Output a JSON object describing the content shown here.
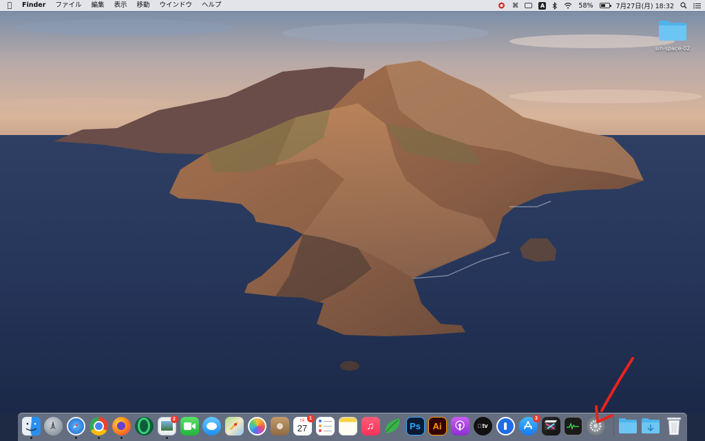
{
  "menubar": {
    "apple_icon": "apple-icon",
    "app_name": "Finder",
    "menus": [
      "ファイル",
      "編集",
      "表示",
      "移動",
      "ウインドウ",
      "ヘルプ"
    ],
    "status": {
      "battery_percent": "58%",
      "clock": "7月27日(月)  18:32",
      "input_source_label": "A",
      "icons": [
        "creative-cloud-icon",
        "command-icon",
        "keyboard-viewer-icon",
        "input-source-icon",
        "bluetooth-icon",
        "wifi-icon",
        "battery-icon",
        "spotlight-icon",
        "control-center-icon"
      ]
    }
  },
  "desktop": {
    "folder_label": "sin-space-02"
  },
  "dock": {
    "apps": [
      {
        "name": "Finder",
        "icon": "finder-icon",
        "running": true
      },
      {
        "name": "Launchpad",
        "icon": "launchpad-icon",
        "running": false
      },
      {
        "name": "Safari",
        "icon": "safari-icon",
        "running": true
      },
      {
        "name": "Google Chrome",
        "icon": "chrome-icon",
        "running": true
      },
      {
        "name": "Firefox",
        "icon": "firefox-icon",
        "running": true
      },
      {
        "name": "Opera",
        "icon": "opera-icon",
        "running": false
      },
      {
        "name": "Preview",
        "icon": "preview-icon",
        "running": true,
        "badge": "2"
      },
      {
        "name": "FaceTime",
        "icon": "facetime-icon",
        "running": false
      },
      {
        "name": "Messages",
        "icon": "messages-icon",
        "running": false
      },
      {
        "name": "Maps",
        "icon": "maps-icon",
        "running": false
      },
      {
        "name": "Photos",
        "icon": "photos-icon",
        "running": false
      },
      {
        "name": "Contacts",
        "icon": "contacts-icon",
        "running": false
      },
      {
        "name": "Calendar",
        "icon": "calendar-icon",
        "running": false,
        "badge": "1",
        "month": "7月",
        "day": "27"
      },
      {
        "name": "Reminders",
        "icon": "reminders-icon",
        "running": false
      },
      {
        "name": "Notes",
        "icon": "notes-icon",
        "running": false
      },
      {
        "name": "Music",
        "icon": "music-icon",
        "running": false
      },
      {
        "name": "Evernote",
        "icon": "evernote-icon",
        "running": false
      },
      {
        "name": "Photoshop",
        "icon": "photoshop-icon",
        "running": false,
        "label": "Ps"
      },
      {
        "name": "Illustrator",
        "icon": "illustrator-icon",
        "running": false,
        "label": "Ai"
      },
      {
        "name": "Podcasts",
        "icon": "podcasts-icon",
        "running": false
      },
      {
        "name": "Apple TV",
        "icon": "appletv-icon",
        "running": false,
        "label": "tv"
      },
      {
        "name": "1Password",
        "icon": "onepassword-icon",
        "running": false
      },
      {
        "name": "App Store",
        "icon": "appstore-icon",
        "running": false,
        "badge": "3"
      },
      {
        "name": "Final Cut Pro",
        "icon": "finalcut-icon",
        "running": false
      },
      {
        "name": "Activity Monitor",
        "icon": "activity-monitor-icon",
        "running": false
      },
      {
        "name": "System Preferences",
        "icon": "system-preferences-icon",
        "running": false
      },
      {
        "name": "Folder",
        "icon": "folder-icon",
        "running": false
      },
      {
        "name": "Downloads",
        "icon": "downloads-folder-icon",
        "running": false
      },
      {
        "name": "Trash",
        "icon": "trash-icon",
        "running": false
      }
    ]
  },
  "annotation": {
    "arrow_color": "#e8231f",
    "points_to": "System Preferences"
  }
}
